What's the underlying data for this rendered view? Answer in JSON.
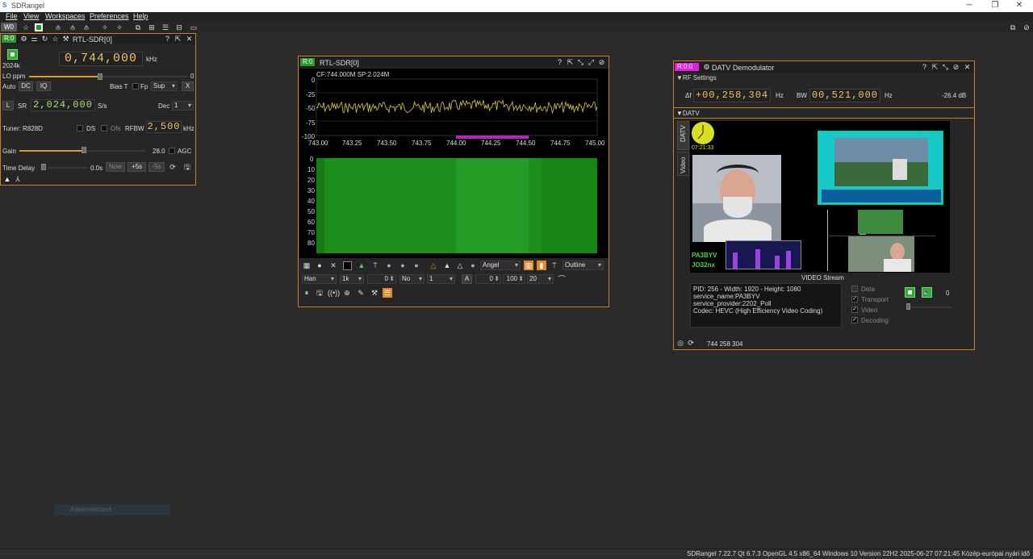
{
  "window": {
    "title": "SDRangel",
    "logo": "S",
    "minimize": "─",
    "restore": "❐",
    "close": "✕"
  },
  "menu": [
    "File",
    "View",
    "Workspaces",
    "Preferences",
    "Help"
  ],
  "toolbar": {
    "workspace": "W0"
  },
  "rtl_panel": {
    "badge": "R:0",
    "title": "RTL-SDR[0]",
    "frequency": "0,744,000",
    "freq_unit": "kHz",
    "sample_rate_label": "2024k",
    "lo_ppm_label": "LO ppm",
    "lo_ppm_value": "0",
    "auto": "Auto",
    "dc": "DC",
    "iq": "IQ",
    "bias_t": "Bias T",
    "fp": "Fp",
    "sup": "Sup",
    "x": "X",
    "l": "L",
    "sr_label": "SR",
    "sr_value": "2,024,000",
    "sr_unit": "S/s",
    "dec_label": "Dec",
    "dec_value": "1",
    "tuner": "Tuner: R828D",
    "ds": "DS",
    "ofs": "Ofs",
    "rfbw_label": "RFBW",
    "rfbw_value": "2,500",
    "rfbw_unit": "kHz",
    "gain_label": "Gain",
    "gain_value": "28.0",
    "agc": "AGC",
    "gain_level": 0.36,
    "time_delay_label": "Time Delay",
    "time_delay_value": "0.0s",
    "now": "Now",
    "plus5": "+5s",
    "minus5": "-5s"
  },
  "spectrum_panel": {
    "badge": "R:0",
    "title": "RTL-SDR[0]",
    "info": "CF:744.000M SP:2.024M",
    "y_ticks": [
      "0",
      "-25",
      "-50",
      "-75",
      "-100"
    ],
    "x_ticks": [
      "743.00",
      "743.25",
      "743.50",
      "743.75",
      "744.00",
      "744.25",
      "744.50",
      "744.75",
      "745.00"
    ],
    "wf_ticks": [
      "0",
      "10",
      "20",
      "30",
      "40",
      "50",
      "60",
      "70",
      "80"
    ],
    "palette": "Angel",
    "outline": "Outline",
    "window": "Han",
    "fft": "1k",
    "zero1": "0",
    "no": "No",
    "one": "1",
    "a": "A",
    "zero2": "0",
    "hundred": "100",
    "twenty": "20"
  },
  "datv_panel": {
    "badge": "R:0:0",
    "title": "DATV Demodulator",
    "rf_section": "RF Settings",
    "delta_label": "Δf",
    "delta_value": "+00,258,304",
    "hz1": "Hz",
    "bw_label": "BW",
    "bw_value": "00,521,000",
    "hz2": "Hz",
    "power": "-26.4 dB",
    "datv_section": "DATV",
    "tab_datv": "DATV",
    "tab_video": "Video",
    "clock": "07:21:33",
    "callsign": "PA3BYV",
    "locator": "JO32nx",
    "video_stream": "VIDEO Stream",
    "stream_info": [
      "PID: 256 - Width: 1920 - Height: 1080",
      "service_name:PA3BYV",
      "service_provider:2202_Poll",
      "Codec: HEVC (High Efficiency Video Coding)"
    ],
    "data_lbl": "Data",
    "transport_lbl": "Transport",
    "video_lbl": "Video",
    "decoding_lbl": "Decoding",
    "volume_value": "0",
    "footer_freq": "744 258 304"
  },
  "ghost_label": "Áblakmenüzet",
  "status_bar": "SDRangel 7.22.7 Qt 6.7.3 OpenGL 4.5 x86_64 Windows 10 Version 22H2  2025-06-27 07:21:45 Közép-európai nyári idő"
}
